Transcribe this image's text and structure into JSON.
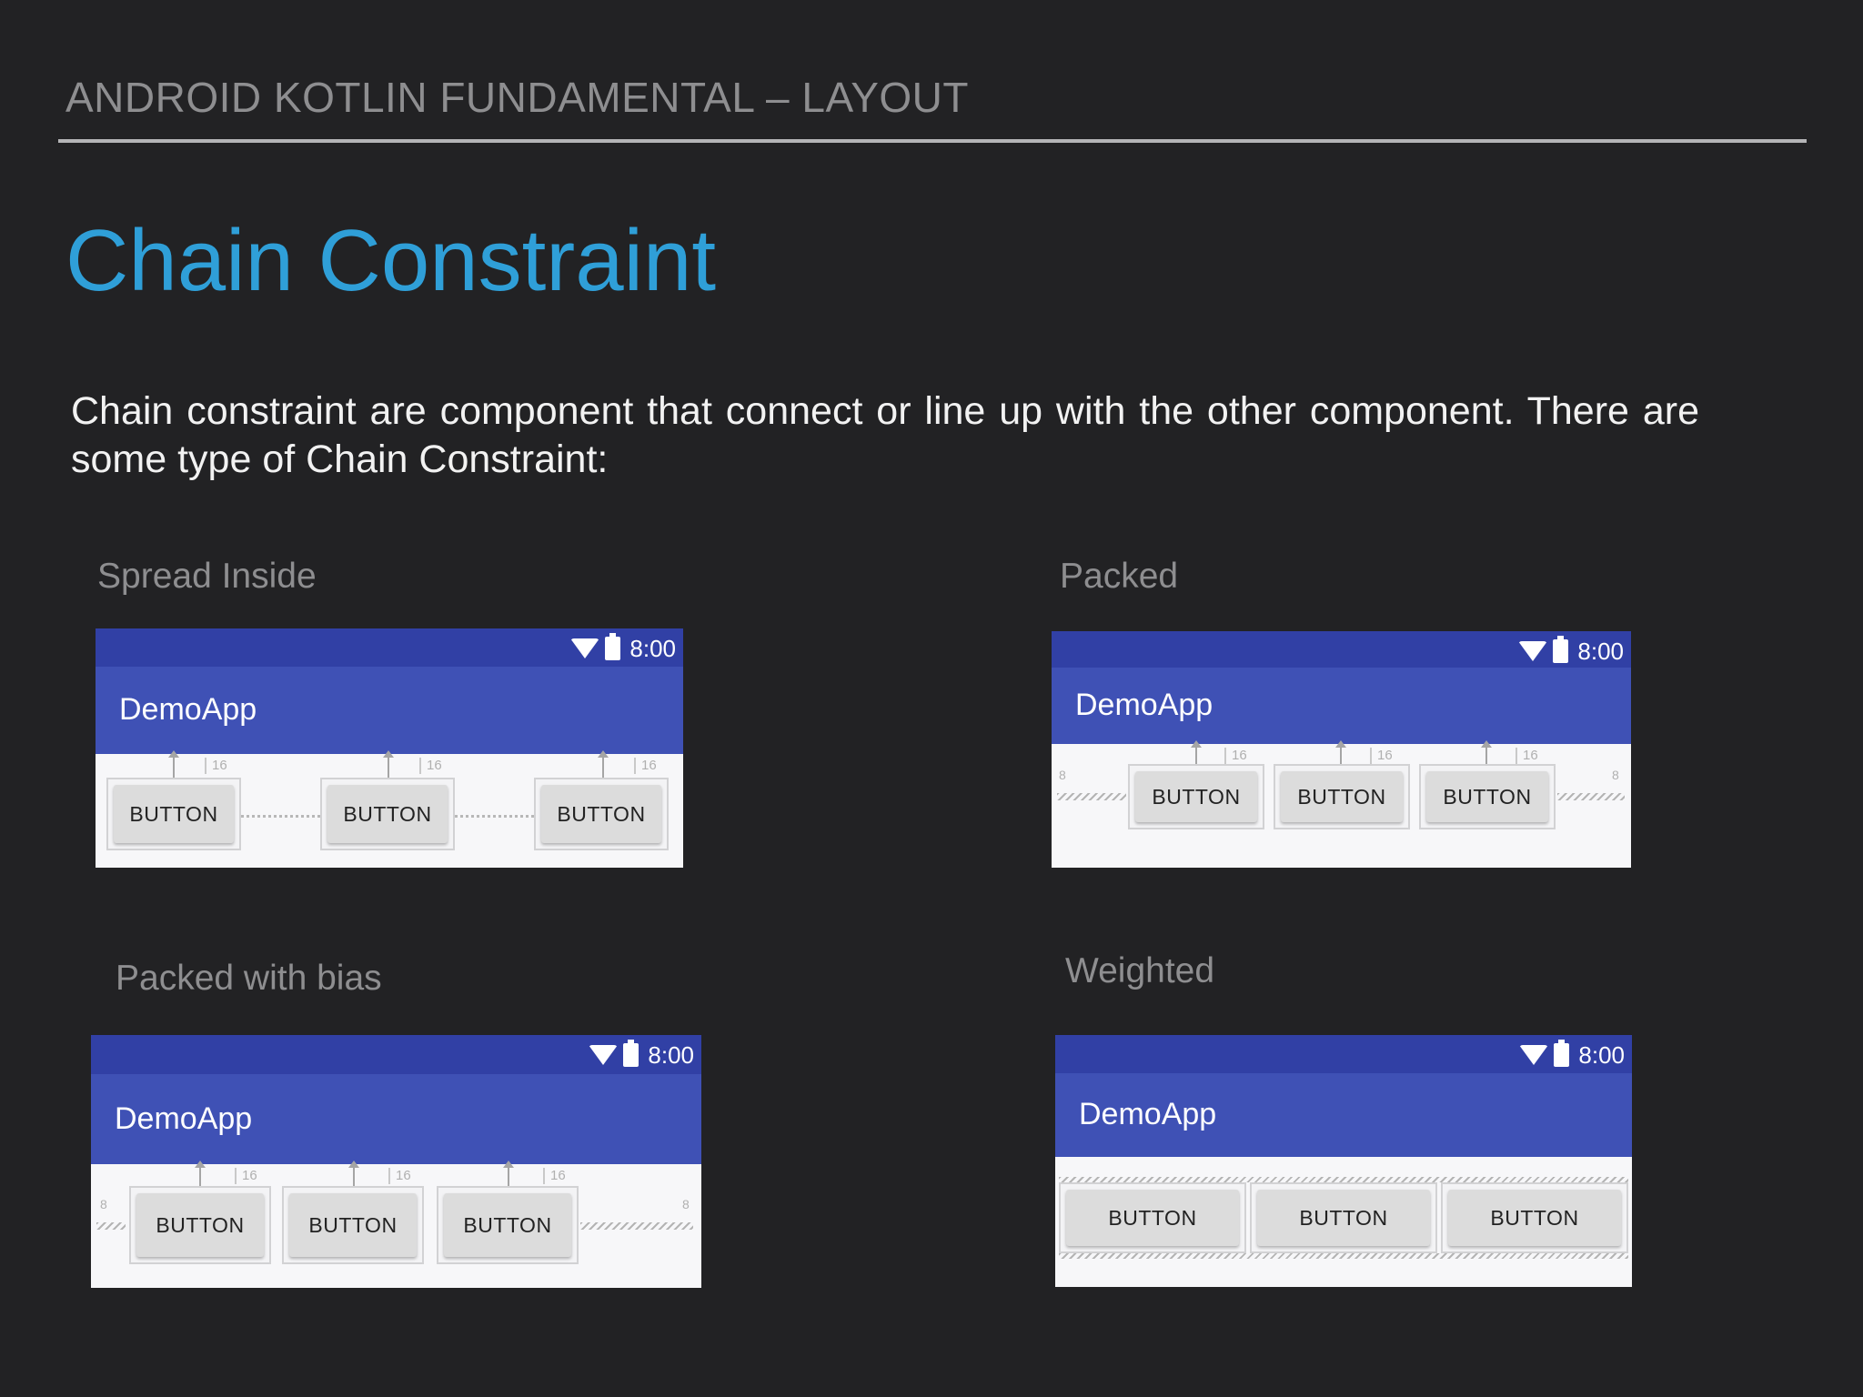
{
  "header": {
    "title": "ANDROID KOTLIN FUNDAMENTAL – LAYOUT"
  },
  "slide": {
    "title": "Chain Constraint"
  },
  "description": "Chain constraint are component that connect or line up with the other component. There are some type of Chain Constraint:",
  "status_bar": {
    "time": "8:00"
  },
  "app_title": "DemoApp",
  "button_label": "BUTTON",
  "margin_value": "16",
  "edge_margin_value": "8",
  "examples": [
    {
      "caption": "Spread Inside"
    },
    {
      "caption": "Packed"
    },
    {
      "caption": "Packed with bias"
    },
    {
      "caption": "Weighted"
    }
  ],
  "colors": {
    "background": "#222224",
    "title_accent": "#2f9fd8",
    "status_bar": "#3140a5",
    "app_bar": "#3f51b5"
  },
  "icons": [
    "wifi-icon",
    "battery-icon"
  ]
}
